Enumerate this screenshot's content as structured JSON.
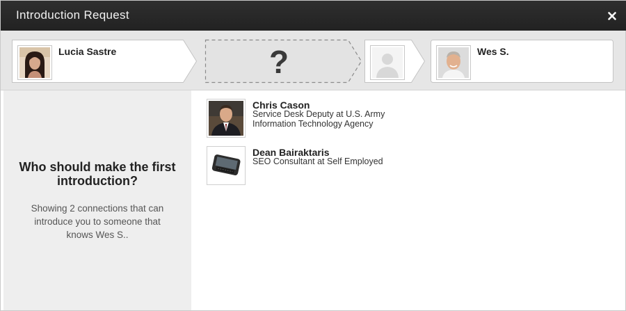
{
  "dialog": {
    "title": "Introduction Request",
    "close_label": "×"
  },
  "path": {
    "from_name": "Lucia Sastre",
    "unknown_symbol": "?",
    "to_name": "Wes S."
  },
  "left_panel": {
    "heading": "Who should make the first introduction?",
    "description": "Showing 2 connections that can introduce you to someone that knows Wes S.."
  },
  "connections": [
    {
      "name": "Chris Cason",
      "headline": "Service Desk Deputy at U.S. Army Information Technology Agency",
      "photo_icon": "person-photo"
    },
    {
      "name": "Dean Bairaktaris",
      "headline": "SEO Consultant at Self Employed",
      "photo_icon": "phone-photo"
    }
  ],
  "colors": {
    "header_bg": "#262626",
    "path_bar_bg": "#e6e6e6",
    "left_panel_bg": "#eeeeee"
  }
}
